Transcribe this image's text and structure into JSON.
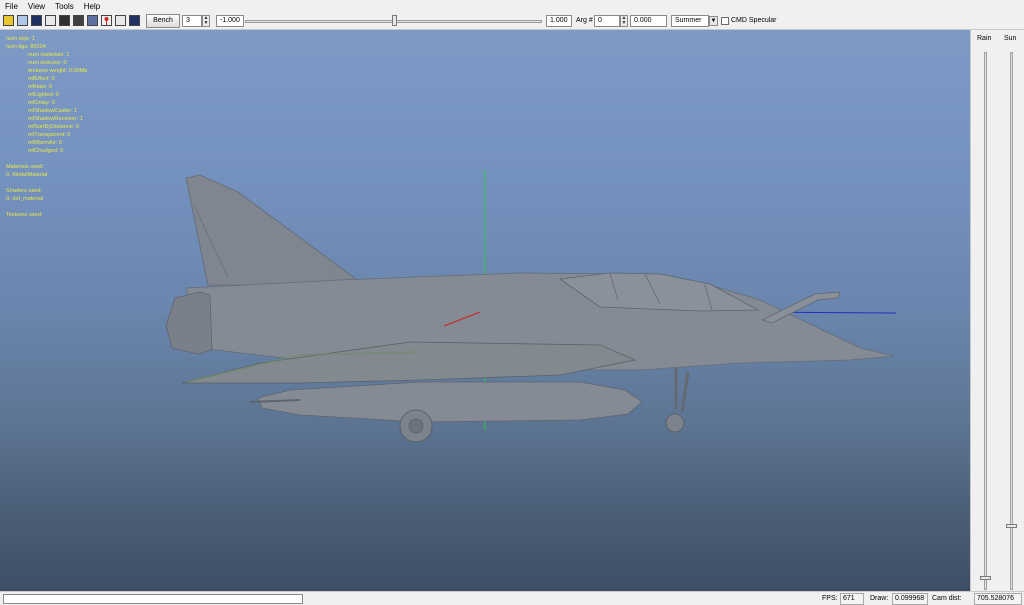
{
  "menu": {
    "items": [
      "File",
      "View",
      "Tools",
      "Help"
    ]
  },
  "toolbar": {
    "icons": [
      "open-icon",
      "save-icon",
      "texture-icon",
      "render-icon",
      "wireframe-icon",
      "grid-icon",
      "skeleton-icon",
      "light-icon",
      "camera-icon"
    ],
    "bench_label": "Bench",
    "bench_value": "3",
    "range_min": "-1.000",
    "range_max": "1.000",
    "arg_label": "Arg #",
    "arg_value": "0",
    "arg_float": "0.000",
    "season_value": "Summer",
    "cmd_specular_label": "CMD Specular",
    "cmd_specular_checked": false
  },
  "stats": {
    "lines": [
      "num objs: 1",
      "num tigs: 80104"
    ],
    "indented": [
      "num materials: 1",
      "num textures: 0",
      "textures weight: 0.00Mb",
      "mfEffect: 0",
      "mfHalo: 0",
      "mfLighted: 0",
      "mfOnlay: 0",
      "mfShadowCaster: 1",
      "mfShadowReceiver: 1",
      "mfSortByDistance: 0",
      "mfTransparent: 0",
      "mfWarmAir: 0",
      "mfChudged: 0"
    ],
    "materials_title": "Materials used:",
    "materials": [
      "0. ModelMaterial"
    ],
    "shaders_title": "Shaders used:",
    "shaders": [
      "0. def_material"
    ],
    "textures_title": "Textures used:"
  },
  "right_panel": {
    "rain_label": "Rain",
    "sun_label": "Sun",
    "rain_level": 0.0,
    "sun_level": 0.05
  },
  "status": {
    "fps_label": "FPS:",
    "fps_value": "671",
    "draw_label": "Draw:",
    "draw_value": "0.099968",
    "cam_label": "Cam dist:",
    "cam_value": "705.528076"
  },
  "colors": {
    "stats_text": "#e8e84a",
    "axis_y": "#2ec84a",
    "axis_z": "#2030c0",
    "axis_x": "#d02020",
    "model": "#7f8590"
  }
}
